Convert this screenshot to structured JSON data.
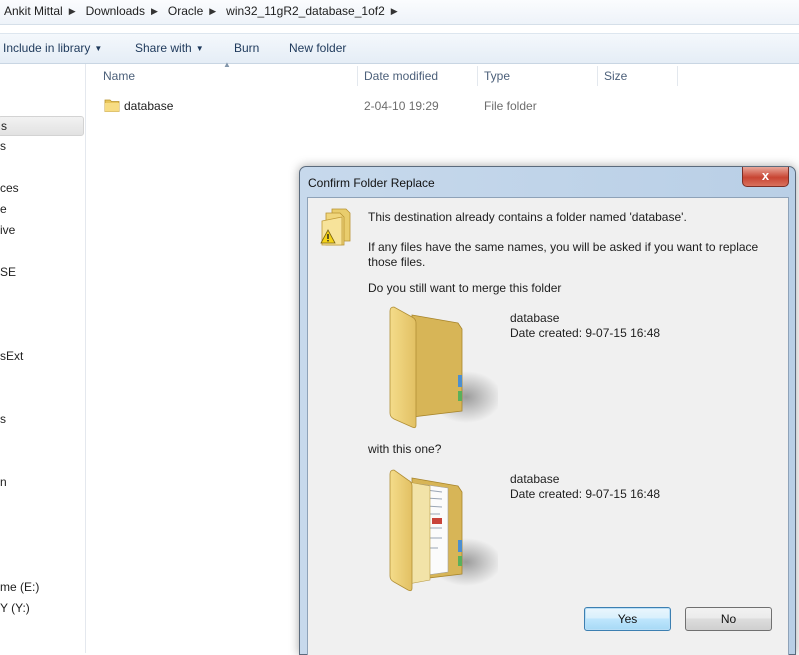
{
  "breadcrumb": [
    "Ankit Mittal",
    "Downloads",
    "Oracle",
    "win32_11gR2_database_1of2"
  ],
  "address_right": "",
  "toolbar": {
    "include_library": "Include in library",
    "share_with": "Share with",
    "burn": "Burn",
    "new_folder": "New folder"
  },
  "nav": [
    "s",
    "s",
    "ces",
    "e",
    "ive",
    "SE",
    "sExt",
    "s",
    "n",
    "me (E:)",
    "Y (Y:)"
  ],
  "columns": {
    "name": "Name",
    "date": "Date modified",
    "type": "Type",
    "size": "Size"
  },
  "files": [
    {
      "name": "database",
      "date": "2-04-10 19:29",
      "type": "File folder",
      "size": ""
    }
  ],
  "dialog": {
    "title": "Confirm Folder Replace",
    "close_glyph": "x",
    "line1": "This destination already contains a folder named 'database'.",
    "line2": "If any files have the same names, you will be asked if you want to replace those files.",
    "line3": "Do you still want to merge this folder",
    "source": {
      "name": "database",
      "date": "Date created: 9-07-15 16:48"
    },
    "with_text": "with this one?",
    "dest": {
      "name": "database",
      "date": "Date created: 9-07-15 16:48"
    },
    "yes": "Yes",
    "no": "No"
  }
}
